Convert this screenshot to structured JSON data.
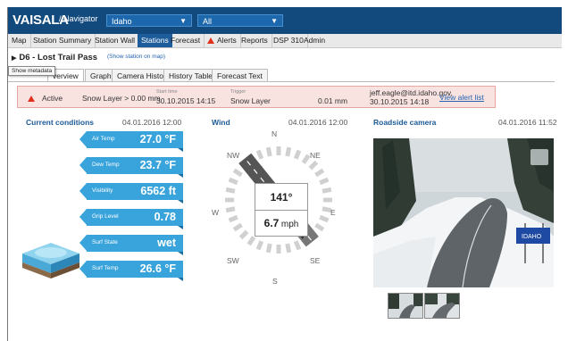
{
  "header": {
    "brand": "VAISALA",
    "crumb": "/ Navigator",
    "region_select": "Idaho",
    "filter_select": "All"
  },
  "tabs": [
    "Map",
    "Station Summary",
    "Station Wall",
    "Stations",
    "Forecast",
    "Alerts",
    "Reports",
    "DSP 310",
    "Admin"
  ],
  "active_tab": "Stations",
  "station": {
    "name": "D6 - Lost Trail Pass",
    "show_map": "(Show station on map)",
    "tooltip": "Show metadata",
    "subtabs": [
      "Overview",
      "Graph",
      "Camera History",
      "History Table",
      "Forecast Text"
    ],
    "overview_visible": "verview"
  },
  "alert": {
    "status": "Active",
    "condition": "Snow Layer > 0.00 mm",
    "start_label": "Start time",
    "start_time": "30.10.2015 14:15",
    "trigger_label": "Trigger",
    "trigger": "Snow Layer",
    "trigger_value": "0.01 mm",
    "user": "jeff.eagle@itd.idaho.gov,",
    "user_time": "30.10.2015 14:18",
    "link": "View alert list"
  },
  "current": {
    "title": "Current conditions",
    "date": "04.01.2016 12:00",
    "items": [
      {
        "label": "Air Temp",
        "value": "27.0 °F"
      },
      {
        "label": "Dew Temp",
        "value": "23.7 °F"
      },
      {
        "label": "Visibility",
        "value": "6562 ft"
      },
      {
        "label": "Grip Level",
        "value": "0.78"
      },
      {
        "label": "Surf State",
        "value": "wet"
      },
      {
        "label": "Surf Temp",
        "value": "26.6 °F"
      }
    ]
  },
  "wind": {
    "title": "Wind",
    "date": "04.01.2016 12:00",
    "direction": "141°",
    "speed": "6.7",
    "unit": "mph",
    "labels": {
      "n": "N",
      "ne": "NE",
      "e": "E",
      "se": "SE",
      "s": "S",
      "sw": "SW",
      "w": "W",
      "nw": "NW"
    }
  },
  "camera": {
    "title": "Roadside camera",
    "date": "04.01.2016 11:52",
    "sign": "IDAHO"
  },
  "colors": {
    "header_bg": "#134a7d",
    "active_tab": "#1d5d9b",
    "ribbon": "#39a3db",
    "alert_bg": "#f9e3e1",
    "alert_icon": "#e0301e",
    "section_title": "#1c5a96"
  }
}
